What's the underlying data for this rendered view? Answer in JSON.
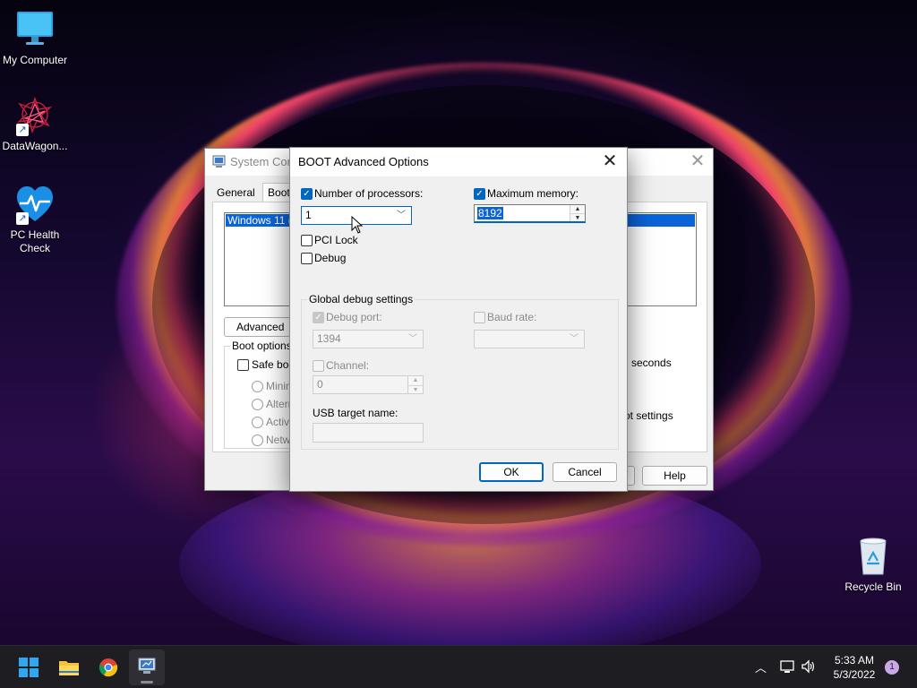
{
  "desktop": {
    "icons": [
      {
        "label": "My Computer"
      },
      {
        "label": "DataWagon..."
      },
      {
        "label": "PC Health Check"
      },
      {
        "label": "Recycle Bin"
      }
    ]
  },
  "syscfg": {
    "title": "System Conf",
    "tabs": [
      "General",
      "Boot"
    ],
    "os_entry": "Windows 11 (C",
    "advanced_button": "Advanced op",
    "boot_options_legend": "Boot options",
    "safe_boot_label": "Safe boo",
    "safe_boot_options": [
      "Minima",
      "Altern",
      "Active",
      "Netwo"
    ],
    "timeout_suffix": "seconds",
    "make_permanent_suffix": "ot settings",
    "help_button": "Help"
  },
  "bootadv": {
    "title": "BOOT Advanced Options",
    "num_processors": {
      "label": "Number of processors:",
      "checked": true,
      "value": "1"
    },
    "max_memory": {
      "label": "Maximum memory:",
      "checked": true,
      "value": "8192"
    },
    "pci_lock": {
      "label": "PCI Lock",
      "checked": false
    },
    "debug": {
      "label": "Debug",
      "checked": false
    },
    "global_debug": {
      "legend": "Global debug settings",
      "debug_port": {
        "label": "Debug port:",
        "checked": true,
        "value": "1394"
      },
      "baud_rate": {
        "label": "Baud rate:",
        "checked": false,
        "value": ""
      },
      "channel": {
        "label": "Channel:",
        "checked": false,
        "value": "0"
      },
      "usb_target_label": "USB target name:",
      "usb_target_value": ""
    },
    "ok_button": "OK",
    "cancel_button": "Cancel"
  },
  "taskbar": {
    "clock_time": "5:33 AM",
    "clock_date": "5/3/2022",
    "notification_count": "1"
  },
  "colors": {
    "accent": "#0067c0",
    "selection": "#0a64d8",
    "taskbar": "#1e1e22"
  }
}
